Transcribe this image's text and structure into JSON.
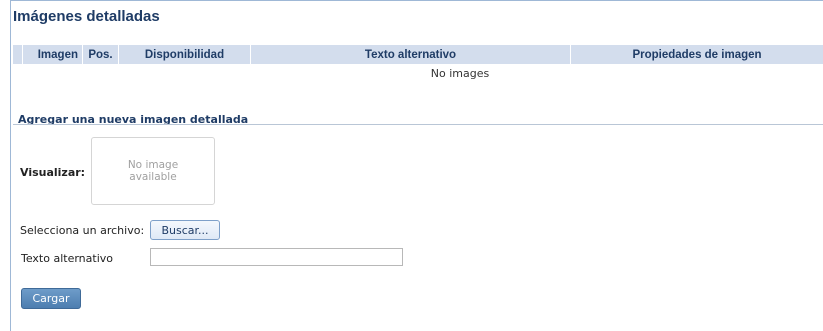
{
  "panel": {
    "title": "Imágenes detalladas"
  },
  "table": {
    "columns": [
      "Imagen",
      "Pos.",
      "Disponibilidad",
      "Texto alternativo",
      "Propiedades de imagen"
    ],
    "empty_message": "No images"
  },
  "add_section": {
    "title": "Agregar una nueva imagen detallada",
    "preview_label": "Visualizar:",
    "preview_placeholder_line1": "No image",
    "preview_placeholder_line2": "available",
    "file_label": "Selecciona un archivo:",
    "browse_button": "Buscar...",
    "alt_text_label": "Texto alternativo",
    "alt_text_value": "",
    "upload_button": "Cargar"
  },
  "colors": {
    "header_bg": "#d3dded",
    "heading_text": "#1f3c66",
    "primary_button": "#5a89ba"
  }
}
